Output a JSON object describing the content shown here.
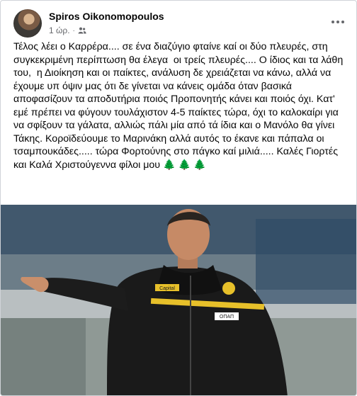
{
  "post": {
    "author": "Spiros Oikonomopoulos",
    "time": "1 ώρ.",
    "separator": "·",
    "audience_icon": "friends-icon",
    "more_icon": "more-options-icon",
    "text": "Τέλος λέει ο Καρρέρα.... σε ένα διαζύγιο φταίνε καί οι δύο πλευρές, στη συγκεκριμένη περίπτωση θα έλεγα  οι τρείς πλευρές.... Ο ίδιος και τα λάθη του,  η Διοίκηση και οι παίκτες, ανάλυση δε χρειάζεται να κάνω, αλλά να έχουμε υπ όψιν μας ότι δε γίνεται να κάνεις ομάδα όταν βασικά αποφασίζουν τα αποδυτήρια ποιός Προπονητής κάνει και ποιός όχι. Κατ' εμέ πρέπει να φύγουν τουλάχιστον 4-5 παίκτες τώρα, όχι το καλοκαίρι για να σφίξουν τα γάλατα, αλλιώς πάλι μία από τά ίδια και ο Μανόλο θα γίνει Τάκης. Κοροϊδεύουμε το Μαρινάκη αλλά αυτός το έκανε και πάπαλα οι τσαμπουκάδες..... τώρα Φορτούνης στο πάγκο καί μιλιά..... Καλές Γιορτές και Καλά Χριστούγεννα φίλοι μου 🌲 🌲 🌲"
  },
  "photo": {
    "description_icon": "post-photo",
    "jacket_badge_left": "Capital",
    "jacket_badge_right": "ΟΠΑΠ"
  }
}
